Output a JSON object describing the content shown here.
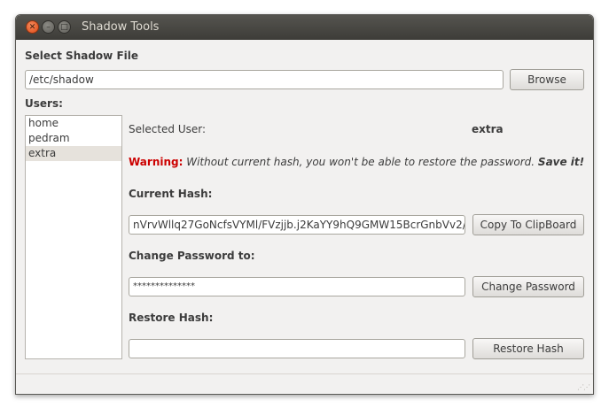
{
  "window": {
    "title": "Shadow Tools"
  },
  "file": {
    "heading": "Select Shadow File",
    "path": "/etc/shadow",
    "browse_label": "Browse"
  },
  "users": {
    "heading": "Users:",
    "items": [
      "home",
      "pedram",
      "extra"
    ],
    "selected_index": 2
  },
  "details": {
    "selected_label": "Selected User:",
    "selected_value": "extra",
    "warning_prefix": "Warning:",
    "warning_text": " Without current hash, you won't be able to restore the password. ",
    "warning_suffix": "Save it!",
    "current_hash_label": "Current Hash:",
    "current_hash_value": "nVrvWllq27GoNcfsVYMl/FVzjjb.j2KaYY9hQ9GMW15BcrGnbVv2/",
    "copy_label": "Copy To ClipBoard",
    "change_label": "Change Password to:",
    "password_value": "**************",
    "change_button_label": "Change Password",
    "restore_label": "Restore Hash:",
    "restore_value": "",
    "restore_button_label": "Restore Hash"
  }
}
